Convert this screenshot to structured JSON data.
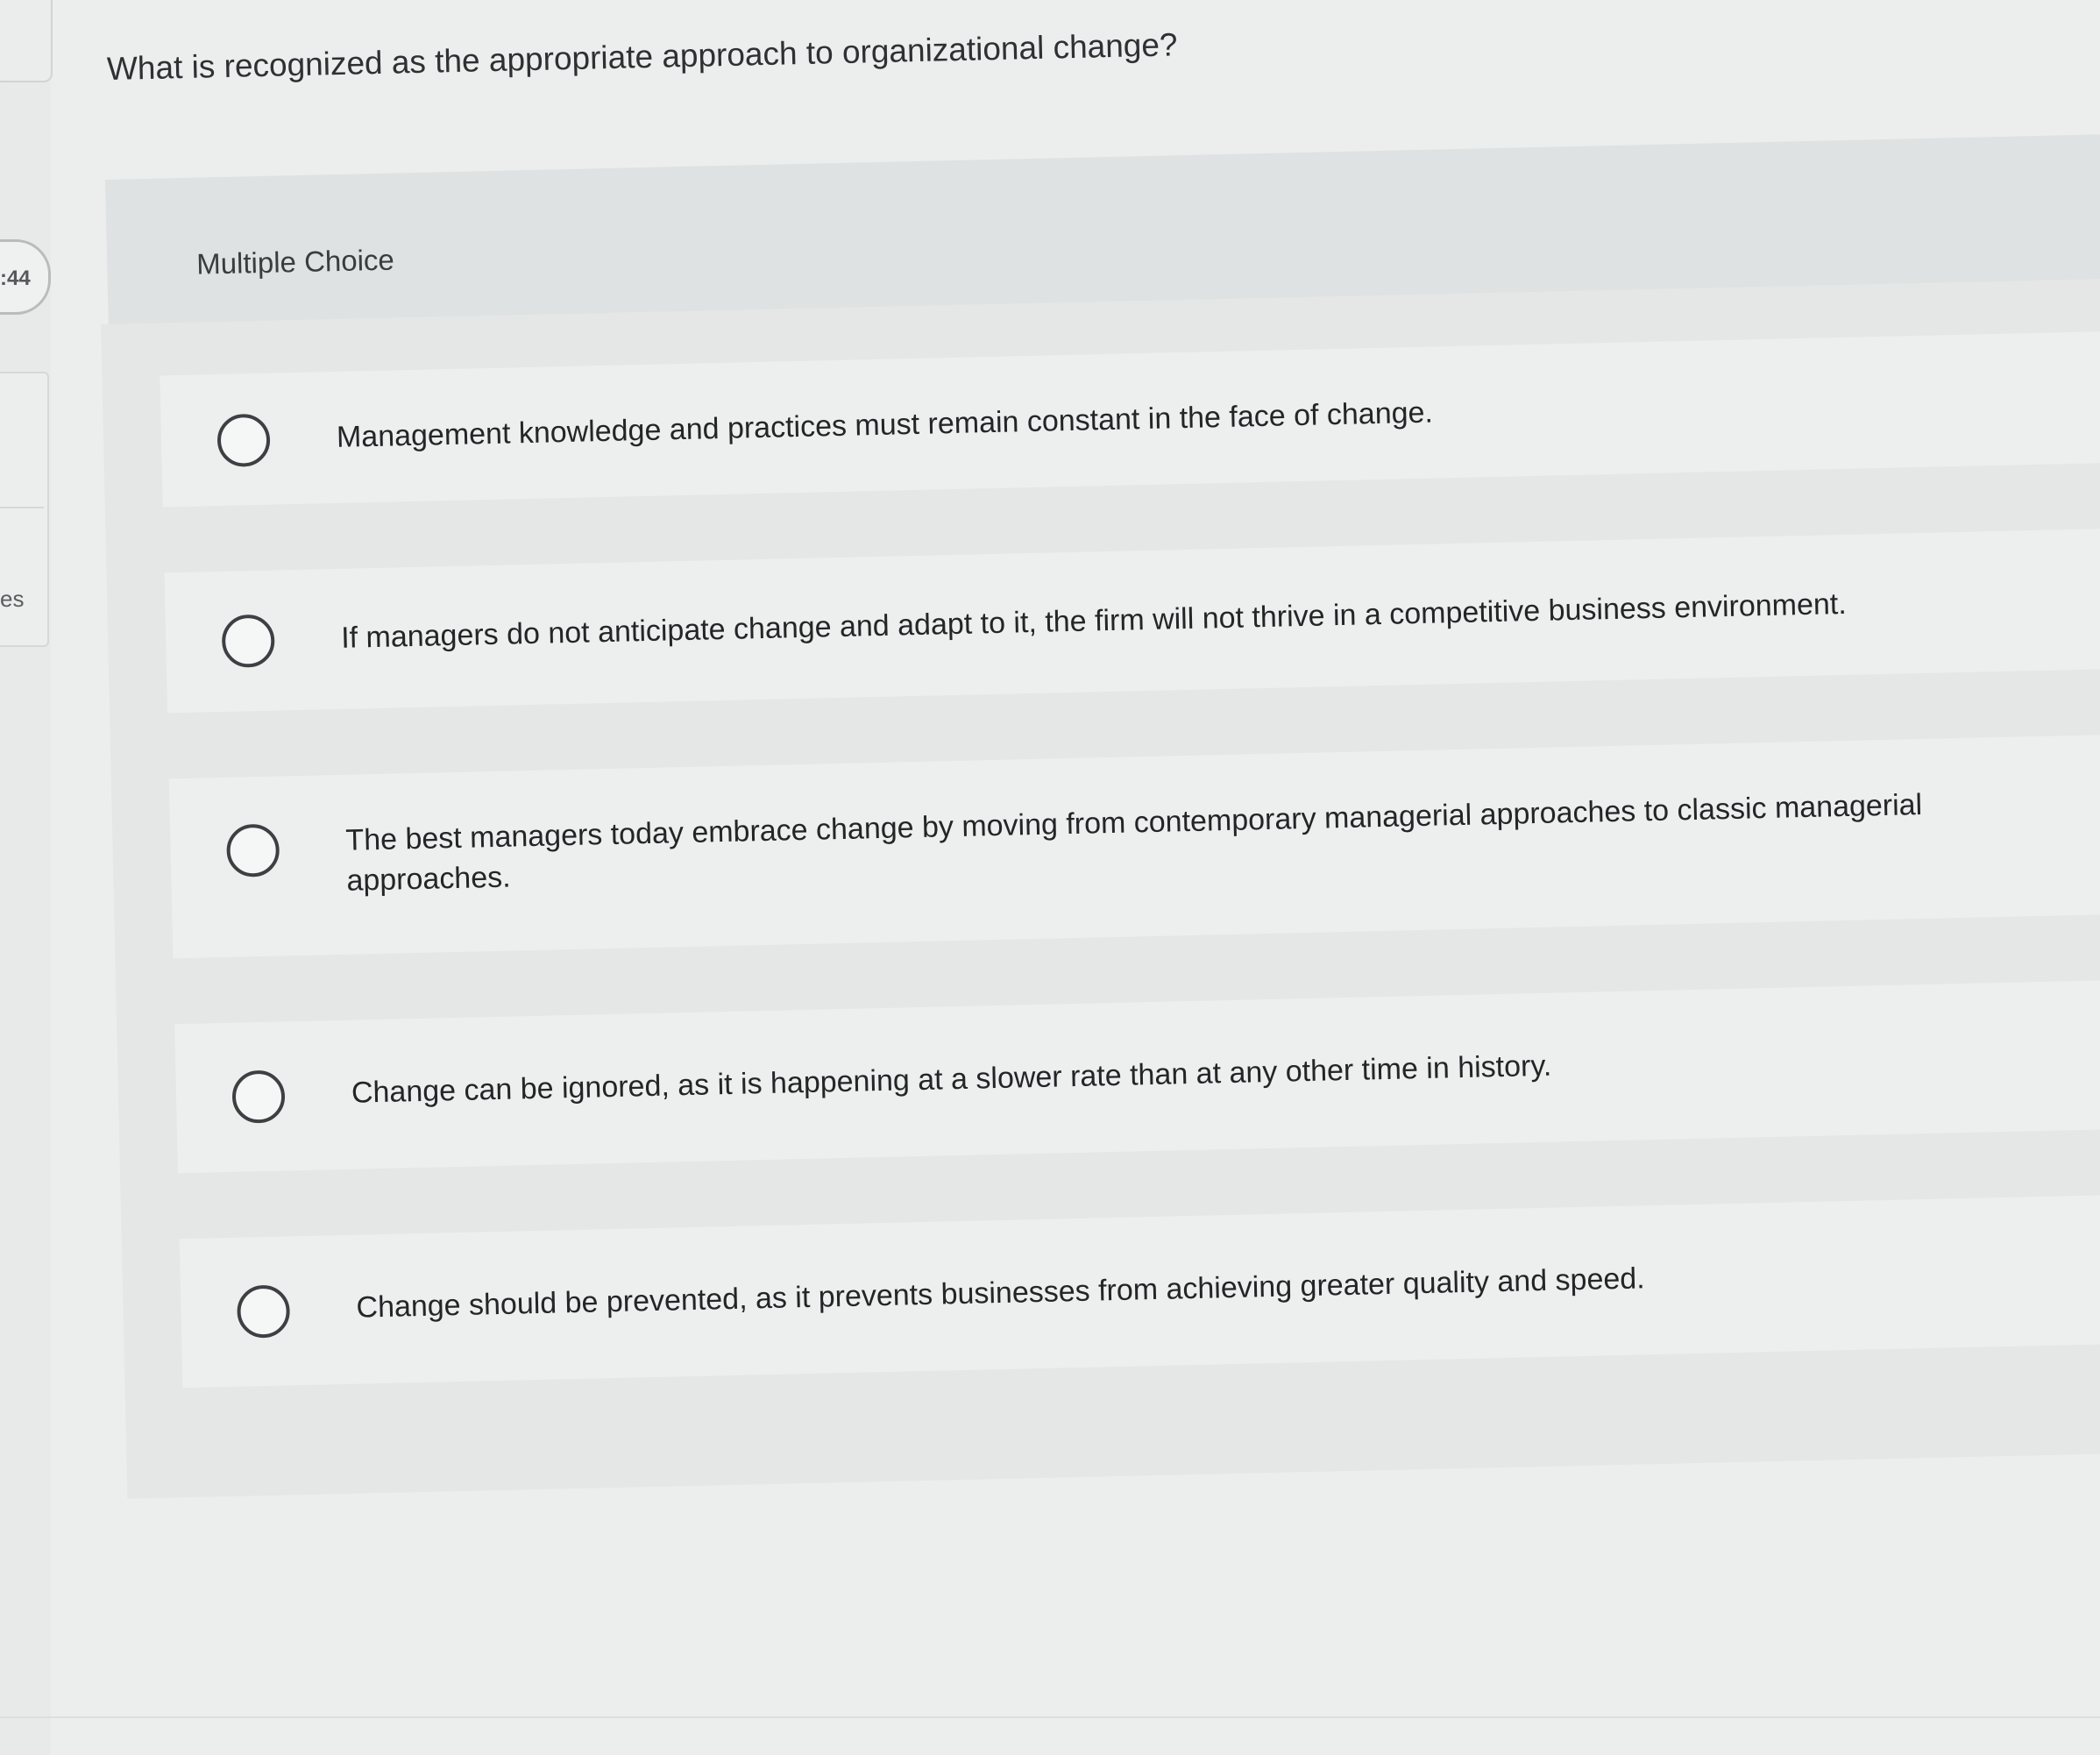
{
  "sidebar": {
    "timer": ":44",
    "partial_label": "es"
  },
  "question": {
    "text": "What is recognized as the appropriate approach to organizational change?"
  },
  "section": {
    "label": "Multiple Choice"
  },
  "options": [
    {
      "text": "Management knowledge and practices must remain constant in the face of change."
    },
    {
      "text": "If managers do not anticipate change and adapt to it, the firm will not thrive in a competitive business environment."
    },
    {
      "text": "The best managers today embrace change by moving from contemporary managerial approaches to classic managerial approaches."
    },
    {
      "text": "Change can be ignored, as it is happening at a slower rate than at any other time in history."
    },
    {
      "text": "Change should be prevented, as it prevents businesses from achieving greater quality and speed."
    }
  ]
}
